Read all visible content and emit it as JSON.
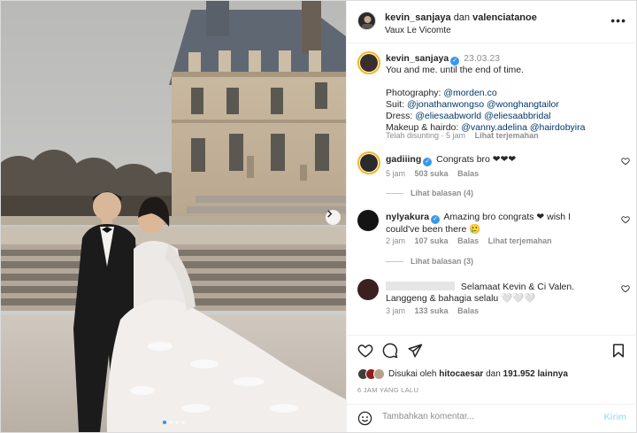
{
  "header": {
    "user1": "kevin_sanjaya",
    "conjunction": "dan",
    "user2": "valenciatanoe",
    "location": "Vaux Le Vicomte",
    "more": "•••"
  },
  "caption": {
    "username": "kevin_sanjaya",
    "date": "23.03.23",
    "lines": [
      "You and me. until the end of time.",
      "Photography:",
      "@morden.co",
      "Suit:",
      "@jonathanwongso",
      "@wonghangtailor",
      "Dress:",
      "@eliesaabworld",
      "@eliesaabbridal",
      "Makeup & hairdo:",
      "@vanny.adelina",
      "@hairdobyira"
    ],
    "meta_edited": "Telah disunting · 5 jam",
    "meta_translate": "Lihat terjemahan"
  },
  "comments": [
    {
      "username": "gadiiing",
      "text": "Congrats bro ❤❤❤",
      "time": "5 jam",
      "likes": "503 suka",
      "reply": "Balas",
      "view_replies": "Lihat balasan (4)"
    },
    {
      "username": "nylyakura",
      "text": "Amazing bro congrats ❤ wish I could've been there 🥲",
      "time": "2 jam",
      "likes": "107 suka",
      "reply": "Balas",
      "translate": "Lihat terjemahan",
      "view_replies": "Lihat balasan (3)"
    },
    {
      "username": "",
      "text": "Selamaat Kevin & Ci Valen. Langgeng & bahagia selalu 🤍🤍🤍",
      "time": "3 jam",
      "likes": "133 suka",
      "reply": "Balas"
    }
  ],
  "likes": {
    "prefix": "Disukai oleh",
    "user": "hitocaesar",
    "conj": "dan",
    "count": "191.952 lainnya"
  },
  "time_ago": "6 JAM YANG LALU",
  "add_comment": {
    "placeholder": "Tambahkan komentar...",
    "post_label": "Kirim"
  },
  "carousel": {
    "total": 4,
    "active": 1
  },
  "icons": {
    "like": "heart-icon",
    "comment": "comment-icon",
    "share": "paper-plane-icon",
    "save": "bookmark-icon",
    "emoji": "smiley-icon",
    "next": "chevron-right-icon"
  },
  "colors": {
    "link": "#00376b",
    "verified": "#3897f0",
    "muted": "#8e8e8e",
    "post_disabled": "#b2dffc"
  }
}
